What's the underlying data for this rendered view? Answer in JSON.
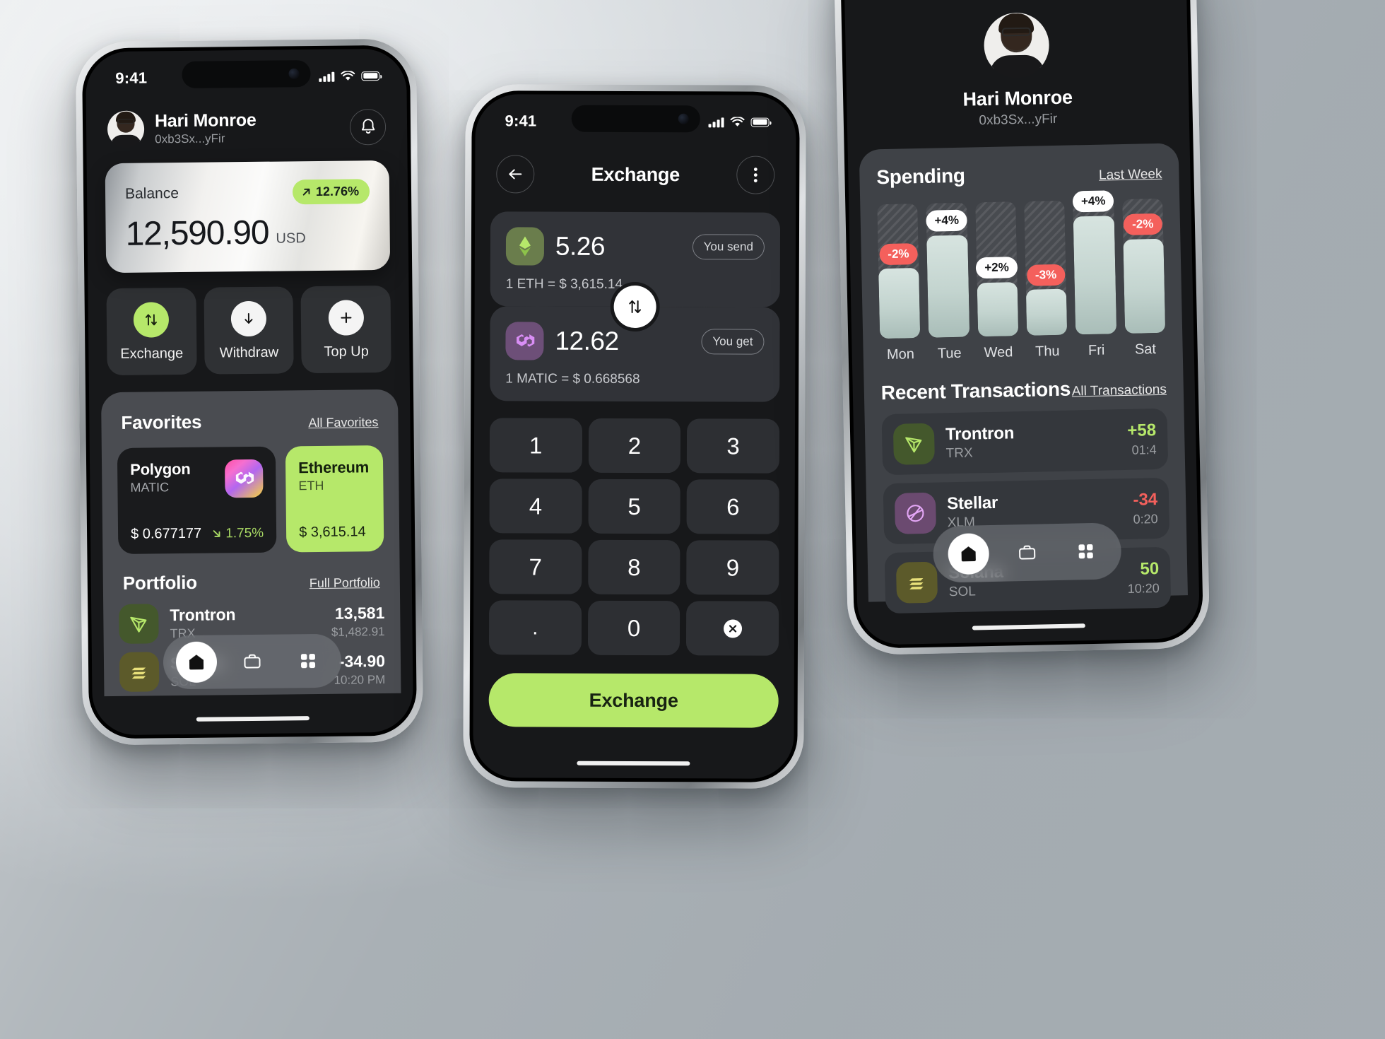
{
  "phone_home": {
    "status": {
      "time": "9:41",
      "signal": "cellular-bars-icon",
      "wifi": "wifi-icon",
      "battery": "battery-full-icon"
    },
    "user": {
      "name": "Hari Monroe",
      "address": "0xb3Sx...yFir"
    },
    "notification_icon": "bell-icon",
    "balance": {
      "label": "Balance",
      "change": "12.76%",
      "change_icon": "arrow-up-right-icon",
      "amount": "12,590.90",
      "currency": "USD"
    },
    "actions": [
      {
        "label": "Exchange",
        "icon": "exchange-arrows-icon",
        "style": "green"
      },
      {
        "label": "Withdraw",
        "icon": "arrow-down-icon",
        "style": "white"
      },
      {
        "label": "Top Up",
        "icon": "plus-icon",
        "style": "white"
      }
    ],
    "favorites": {
      "title": "Favorites",
      "link": "All Favorites",
      "items": [
        {
          "name": "Polygon",
          "ticker": "MATIC",
          "price": "$ 0.677177",
          "delta": "1.75%",
          "delta_dir": "down",
          "icon": "polygon-logo-icon",
          "theme": "dark"
        },
        {
          "name": "Ethereum",
          "ticker": "ETH",
          "price": "$ 3,615.14",
          "delta": "",
          "delta_dir": "",
          "icon": "ethereum-logo-icon",
          "theme": "green"
        }
      ]
    },
    "portfolio": {
      "title": "Portfolio",
      "link": "Full Portfolio",
      "items": [
        {
          "name": "Trontron",
          "ticker": "TRX",
          "amount": "13,581",
          "sub": "$1,482.91",
          "icon": "tron-logo-icon"
        },
        {
          "name": "Solana",
          "ticker": "SOL",
          "amount": "-34.90",
          "sub": "10:20 PM",
          "icon": "solana-logo-icon"
        }
      ]
    },
    "tabbar": [
      {
        "icon": "home-icon",
        "active": true
      },
      {
        "icon": "briefcase-icon",
        "active": false
      },
      {
        "icon": "grid-icon",
        "active": false
      }
    ]
  },
  "phone_exchange": {
    "status": {
      "time": "9:41"
    },
    "back_icon": "arrow-left-icon",
    "title": "Exchange",
    "more_icon": "more-vertical-icon",
    "send": {
      "amount": "5.26",
      "badge": "You send",
      "rate": "1 ETH = $ 3,615.14",
      "icon": "ethereum-logo-icon"
    },
    "get": {
      "amount": "12.62",
      "badge": "You get",
      "rate": "1 MATIC = $ 0.668568",
      "icon": "polygon-logo-icon"
    },
    "swap_icon": "swap-vertical-icon",
    "keypad": [
      "1",
      "2",
      "3",
      "4",
      "5",
      "6",
      "7",
      "8",
      "9",
      ".",
      "0",
      "backspace-icon"
    ],
    "cta": "Exchange"
  },
  "phone_stats": {
    "user": {
      "name": "Hari Monroe",
      "address": "0xb3Sx...yFir"
    },
    "spending": {
      "title": "Spending",
      "link": "Last Week"
    },
    "transactions": {
      "title": "Recent Transactions",
      "link": "All Transactions",
      "items": [
        {
          "name": "Trontron",
          "ticker": "TRX",
          "amount": "+58",
          "time": "01:4",
          "sign": "pos",
          "icon": "tron-logo-icon"
        },
        {
          "name": "Stellar",
          "ticker": "XLM",
          "amount": "-34",
          "time": "0:20",
          "sign": "neg",
          "icon": "stellar-logo-icon"
        },
        {
          "name": "Solana",
          "ticker": "SOL",
          "amount": "50",
          "time": "10:20",
          "sign": "pos",
          "icon": "solana-logo-icon"
        }
      ]
    },
    "tabbar": [
      {
        "icon": "home-icon",
        "active": true
      },
      {
        "icon": "briefcase-icon",
        "active": false
      },
      {
        "icon": "grid-icon",
        "active": false
      }
    ]
  },
  "chart_data": {
    "type": "bar",
    "title": "Spending",
    "categories": [
      "Mon",
      "Tue",
      "Wed",
      "Thu",
      "Fri",
      "Sat"
    ],
    "values": [
      52,
      76,
      40,
      34,
      88,
      70
    ],
    "labels": [
      "-2%",
      "+4%",
      "+2%",
      "-3%",
      "+4%",
      "-2%"
    ],
    "label_kinds": [
      "down",
      "up",
      "up",
      "down",
      "up",
      "down"
    ],
    "xlabel": "",
    "ylabel": "",
    "ylim": [
      0,
      100
    ],
    "grid": false,
    "legend": false
  },
  "colors": {
    "accent_green": "#b6e86a",
    "negative_red": "#f4605c",
    "screen_bg": "#17181a",
    "panel_bg": "#4a4c51",
    "card_bg": "#313338"
  }
}
